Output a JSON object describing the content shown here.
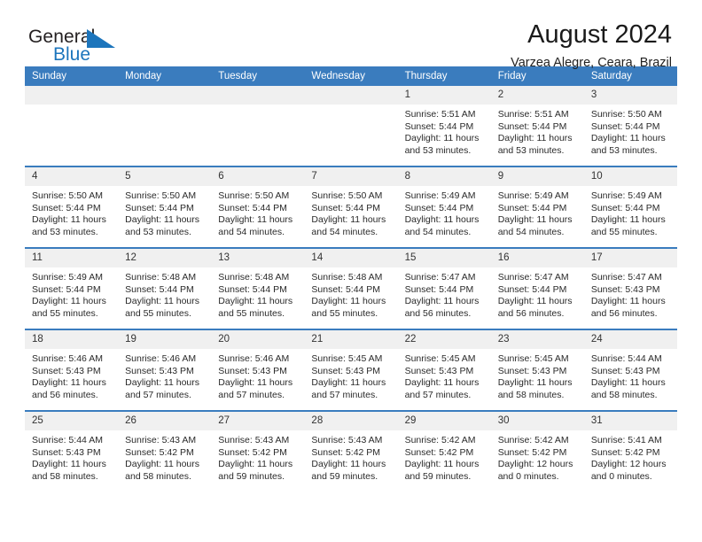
{
  "brand": {
    "name_part1": "General",
    "name_part2": "Blue",
    "accent_color": "#1c75bc"
  },
  "header": {
    "title": "August 2024",
    "subtitle": "Varzea Alegre, Ceara, Brazil"
  },
  "theme": {
    "header_bg": "#3a7cbe",
    "daynum_bg": "#f0f0f0",
    "text": "#2a2a2a"
  },
  "weekdays": [
    "Sunday",
    "Monday",
    "Tuesday",
    "Wednesday",
    "Thursday",
    "Friday",
    "Saturday"
  ],
  "labels": {
    "sunrise_prefix": "Sunrise: ",
    "sunset_prefix": "Sunset: ",
    "daylight_prefix": "Daylight: "
  },
  "weeks": [
    [
      {
        "day": "",
        "sunrise": "",
        "sunset": "",
        "daylight": "",
        "empty": true
      },
      {
        "day": "",
        "sunrise": "",
        "sunset": "",
        "daylight": "",
        "empty": true
      },
      {
        "day": "",
        "sunrise": "",
        "sunset": "",
        "daylight": "",
        "empty": true
      },
      {
        "day": "",
        "sunrise": "",
        "sunset": "",
        "daylight": "",
        "empty": true
      },
      {
        "day": "1",
        "sunrise": "Sunrise: 5:51 AM",
        "sunset": "Sunset: 5:44 PM",
        "daylight": "Daylight: 11 hours and 53 minutes."
      },
      {
        "day": "2",
        "sunrise": "Sunrise: 5:51 AM",
        "sunset": "Sunset: 5:44 PM",
        "daylight": "Daylight: 11 hours and 53 minutes."
      },
      {
        "day": "3",
        "sunrise": "Sunrise: 5:50 AM",
        "sunset": "Sunset: 5:44 PM",
        "daylight": "Daylight: 11 hours and 53 minutes."
      }
    ],
    [
      {
        "day": "4",
        "sunrise": "Sunrise: 5:50 AM",
        "sunset": "Sunset: 5:44 PM",
        "daylight": "Daylight: 11 hours and 53 minutes."
      },
      {
        "day": "5",
        "sunrise": "Sunrise: 5:50 AM",
        "sunset": "Sunset: 5:44 PM",
        "daylight": "Daylight: 11 hours and 53 minutes."
      },
      {
        "day": "6",
        "sunrise": "Sunrise: 5:50 AM",
        "sunset": "Sunset: 5:44 PM",
        "daylight": "Daylight: 11 hours and 54 minutes."
      },
      {
        "day": "7",
        "sunrise": "Sunrise: 5:50 AM",
        "sunset": "Sunset: 5:44 PM",
        "daylight": "Daylight: 11 hours and 54 minutes."
      },
      {
        "day": "8",
        "sunrise": "Sunrise: 5:49 AM",
        "sunset": "Sunset: 5:44 PM",
        "daylight": "Daylight: 11 hours and 54 minutes."
      },
      {
        "day": "9",
        "sunrise": "Sunrise: 5:49 AM",
        "sunset": "Sunset: 5:44 PM",
        "daylight": "Daylight: 11 hours and 54 minutes."
      },
      {
        "day": "10",
        "sunrise": "Sunrise: 5:49 AM",
        "sunset": "Sunset: 5:44 PM",
        "daylight": "Daylight: 11 hours and 55 minutes."
      }
    ],
    [
      {
        "day": "11",
        "sunrise": "Sunrise: 5:49 AM",
        "sunset": "Sunset: 5:44 PM",
        "daylight": "Daylight: 11 hours and 55 minutes."
      },
      {
        "day": "12",
        "sunrise": "Sunrise: 5:48 AM",
        "sunset": "Sunset: 5:44 PM",
        "daylight": "Daylight: 11 hours and 55 minutes."
      },
      {
        "day": "13",
        "sunrise": "Sunrise: 5:48 AM",
        "sunset": "Sunset: 5:44 PM",
        "daylight": "Daylight: 11 hours and 55 minutes."
      },
      {
        "day": "14",
        "sunrise": "Sunrise: 5:48 AM",
        "sunset": "Sunset: 5:44 PM",
        "daylight": "Daylight: 11 hours and 55 minutes."
      },
      {
        "day": "15",
        "sunrise": "Sunrise: 5:47 AM",
        "sunset": "Sunset: 5:44 PM",
        "daylight": "Daylight: 11 hours and 56 minutes."
      },
      {
        "day": "16",
        "sunrise": "Sunrise: 5:47 AM",
        "sunset": "Sunset: 5:44 PM",
        "daylight": "Daylight: 11 hours and 56 minutes."
      },
      {
        "day": "17",
        "sunrise": "Sunrise: 5:47 AM",
        "sunset": "Sunset: 5:43 PM",
        "daylight": "Daylight: 11 hours and 56 minutes."
      }
    ],
    [
      {
        "day": "18",
        "sunrise": "Sunrise: 5:46 AM",
        "sunset": "Sunset: 5:43 PM",
        "daylight": "Daylight: 11 hours and 56 minutes."
      },
      {
        "day": "19",
        "sunrise": "Sunrise: 5:46 AM",
        "sunset": "Sunset: 5:43 PM",
        "daylight": "Daylight: 11 hours and 57 minutes."
      },
      {
        "day": "20",
        "sunrise": "Sunrise: 5:46 AM",
        "sunset": "Sunset: 5:43 PM",
        "daylight": "Daylight: 11 hours and 57 minutes."
      },
      {
        "day": "21",
        "sunrise": "Sunrise: 5:45 AM",
        "sunset": "Sunset: 5:43 PM",
        "daylight": "Daylight: 11 hours and 57 minutes."
      },
      {
        "day": "22",
        "sunrise": "Sunrise: 5:45 AM",
        "sunset": "Sunset: 5:43 PM",
        "daylight": "Daylight: 11 hours and 57 minutes."
      },
      {
        "day": "23",
        "sunrise": "Sunrise: 5:45 AM",
        "sunset": "Sunset: 5:43 PM",
        "daylight": "Daylight: 11 hours and 58 minutes."
      },
      {
        "day": "24",
        "sunrise": "Sunrise: 5:44 AM",
        "sunset": "Sunset: 5:43 PM",
        "daylight": "Daylight: 11 hours and 58 minutes."
      }
    ],
    [
      {
        "day": "25",
        "sunrise": "Sunrise: 5:44 AM",
        "sunset": "Sunset: 5:43 PM",
        "daylight": "Daylight: 11 hours and 58 minutes."
      },
      {
        "day": "26",
        "sunrise": "Sunrise: 5:43 AM",
        "sunset": "Sunset: 5:42 PM",
        "daylight": "Daylight: 11 hours and 58 minutes."
      },
      {
        "day": "27",
        "sunrise": "Sunrise: 5:43 AM",
        "sunset": "Sunset: 5:42 PM",
        "daylight": "Daylight: 11 hours and 59 minutes."
      },
      {
        "day": "28",
        "sunrise": "Sunrise: 5:43 AM",
        "sunset": "Sunset: 5:42 PM",
        "daylight": "Daylight: 11 hours and 59 minutes."
      },
      {
        "day": "29",
        "sunrise": "Sunrise: 5:42 AM",
        "sunset": "Sunset: 5:42 PM",
        "daylight": "Daylight: 11 hours and 59 minutes."
      },
      {
        "day": "30",
        "sunrise": "Sunrise: 5:42 AM",
        "sunset": "Sunset: 5:42 PM",
        "daylight": "Daylight: 12 hours and 0 minutes."
      },
      {
        "day": "31",
        "sunrise": "Sunrise: 5:41 AM",
        "sunset": "Sunset: 5:42 PM",
        "daylight": "Daylight: 12 hours and 0 minutes."
      }
    ]
  ]
}
